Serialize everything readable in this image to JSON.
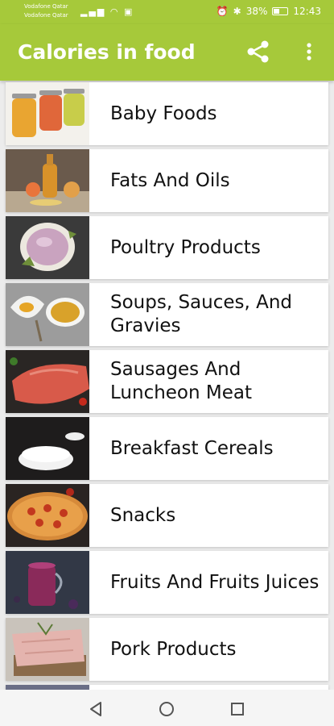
{
  "status_bar": {
    "carrier_1": "Vodafone Qatar",
    "carrier_2": "Vodafone Qatar",
    "battery": "38%",
    "time": "12:43"
  },
  "app_bar": {
    "title": "Calories in food",
    "share_icon": "share-icon",
    "menu_icon": "more-vert-icon",
    "color": "#a6c93a"
  },
  "categories": [
    {
      "label": "Baby Foods"
    },
    {
      "label": "Fats And Oils"
    },
    {
      "label": "Poultry Products"
    },
    {
      "label": "Soups, Sauces, And Gravies"
    },
    {
      "label": "Sausages And Luncheon Meat"
    },
    {
      "label": "Breakfast Cereals"
    },
    {
      "label": "Snacks"
    },
    {
      "label": "Fruits And Fruits Juices"
    },
    {
      "label": "Pork Products"
    }
  ],
  "nav_bar": {
    "back_icon": "back-icon",
    "home_icon": "home-icon",
    "recents_icon": "recents-icon"
  }
}
